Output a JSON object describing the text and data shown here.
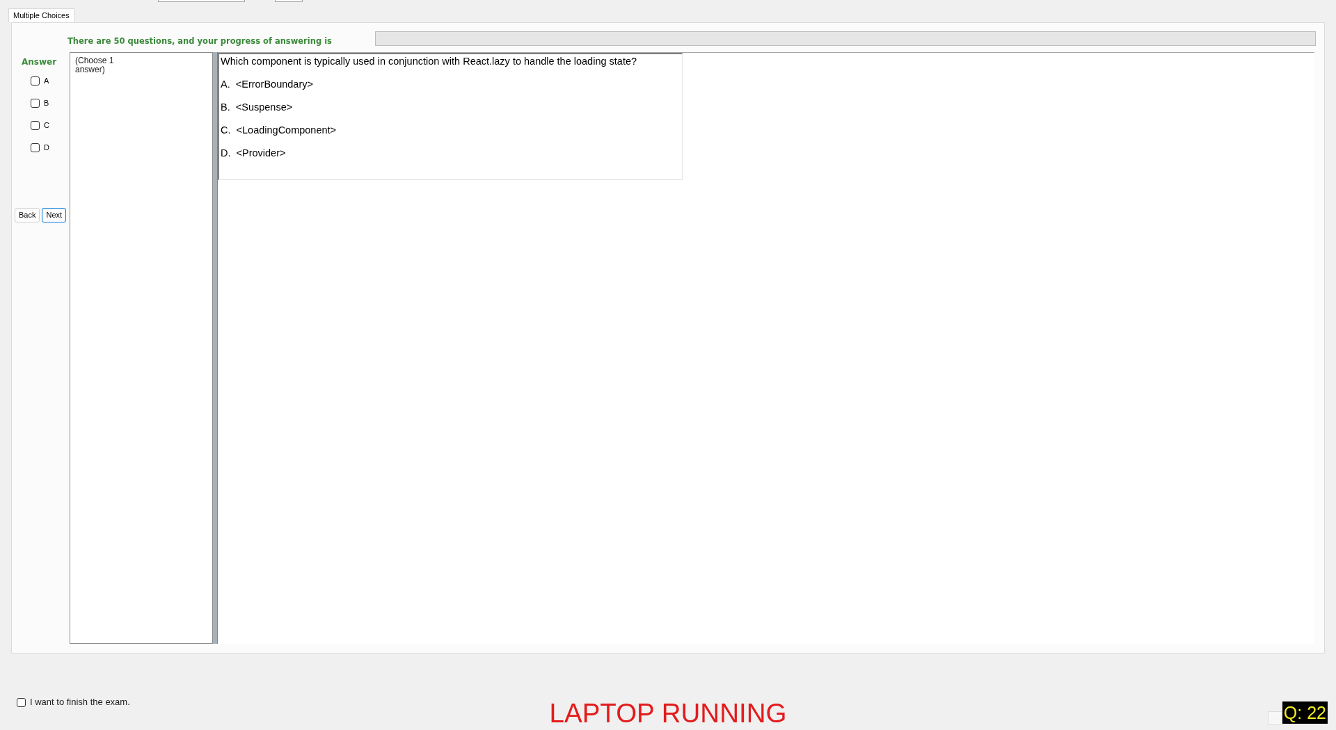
{
  "tab": {
    "label": "Multiple Choices",
    "selected": true
  },
  "progress": {
    "label": "There are 50 questions, and your progress of answering is",
    "level": 0
  },
  "answer_panel": {
    "title": "Answer",
    "options": [
      {
        "label": "A",
        "checked": false
      },
      {
        "label": "B",
        "checked": false
      },
      {
        "label": "C",
        "checked": false
      },
      {
        "label": "D",
        "checked": false
      }
    ]
  },
  "navigation": [
    {
      "label": "Back",
      "focused": false
    },
    {
      "label": "Next",
      "focused": true
    }
  ],
  "hint": "(Choose 1 answer)",
  "question": {
    "text": "Which component is typically used in conjunction with React.lazy to handle the loading state?",
    "options": [
      "A.  <ErrorBoundary>",
      "B.  <Suspense>",
      "C.  <LoadingComponent>",
      "D.  <Provider>"
    ]
  },
  "finish": {
    "label": "I want to finish the exam.",
    "checked": false
  },
  "status": "LAPTOP RUNNING",
  "question_badge": "Q: 22"
}
